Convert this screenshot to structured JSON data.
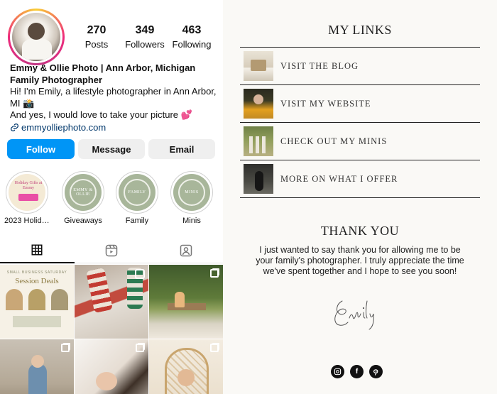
{
  "profile": {
    "stats": [
      {
        "num": "270",
        "label": "Posts"
      },
      {
        "num": "349",
        "label": "Followers"
      },
      {
        "num": "463",
        "label": "Following"
      }
    ],
    "name": "Emmy & Ollie Photo | Ann Arbor, Michigan",
    "category": "Family Photographer",
    "bio_line1": "Hi! I'm Emily, a lifestyle photographer in Ann Arbor, MI 📸",
    "bio_line2": "And yes, I would love to take your picture 💕",
    "website": "emmyolliephoto.com",
    "buttons": {
      "follow": "Follow",
      "message": "Message",
      "email": "Email"
    },
    "highlights": [
      {
        "label": "2023 Holidea...",
        "art": "Holiday Gifts at Emmy"
      },
      {
        "label": "Giveaways",
        "art": "EMMY & OLLIE"
      },
      {
        "label": "Family",
        "art": "FAMILY"
      },
      {
        "label": "Minis",
        "art": "MINIS"
      }
    ],
    "post1": {
      "kicker": "SMALL BUSINESS SATURDAY",
      "title": "Session Deals"
    }
  },
  "links_page": {
    "title": "MY LINKS",
    "links": [
      {
        "label": "VISIT THE BLOG"
      },
      {
        "label": "VISIT MY WEBSITE"
      },
      {
        "label": "CHECK OUT MY MINIS"
      },
      {
        "label": "MORE ON WHAT I OFFER"
      }
    ],
    "thanks_title": "THANK YOU",
    "thanks_body": "I just wanted to say thank you for allowing me to be your family's photographer. I truly appreciate the time we've spent together and I hope to see you soon!",
    "signature": "Emily",
    "socials": [
      "instagram-icon",
      "facebook-icon",
      "pinterest-icon"
    ]
  }
}
